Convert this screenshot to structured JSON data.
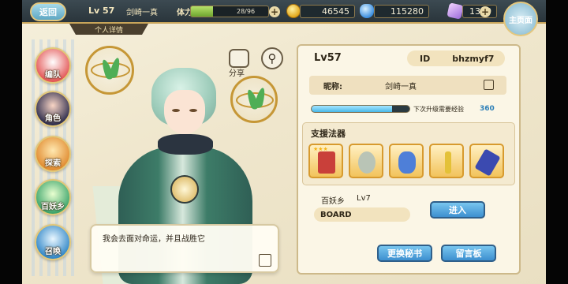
{
  "topbar": {
    "back_label": "返回",
    "level": "Lv 57",
    "player_name": "剑崎一真",
    "stamina_label": "体力",
    "stamina_value": "28/96",
    "stamina_fraction": 0.29,
    "gold": "46545",
    "gems": "115280",
    "crystals": "1390",
    "home_label": "主页面"
  },
  "ribbon": {
    "label": "个人详情"
  },
  "sidebar": {
    "items": [
      {
        "label": "编队"
      },
      {
        "label": "角色"
      },
      {
        "label": "探索"
      },
      {
        "label": "百妖乡"
      },
      {
        "label": "召唤"
      }
    ]
  },
  "share": {
    "label": "分享"
  },
  "dialog": {
    "text": "我会去面对命运，并且战胜它"
  },
  "profile": {
    "level": "Lv57",
    "id_label": "ID",
    "id_value": "bhzmyf7",
    "nickname_label": "昵称:",
    "nickname_value": "剑崎一真",
    "exp_fraction": 0.82,
    "exp_text": "下次升级需要经验",
    "exp_value": "360"
  },
  "support": {
    "title": "支援法器",
    "weapons": [
      {
        "icon": "scroll-icon",
        "color": "#c9403a",
        "stars": "★★★"
      },
      {
        "icon": "ring-icon",
        "color": "#b9c4b6"
      },
      {
        "icon": "monster-icon",
        "color": "#4e7fd8"
      },
      {
        "icon": "staff-icon",
        "color": "#e4c137"
      },
      {
        "icon": "blade-icon",
        "color": "#3b4ab0"
      }
    ]
  },
  "village": {
    "name": "百妖乡",
    "level": "Lv7",
    "board": "BOARD",
    "enter_label": "进入"
  },
  "buttons": {
    "secretary": "更换秘书",
    "message": "留言板"
  },
  "colors": {
    "accent_gold": "#c9a55a",
    "button_blue": "#3d8fcf",
    "panel_bg": "#fbf6e6"
  }
}
